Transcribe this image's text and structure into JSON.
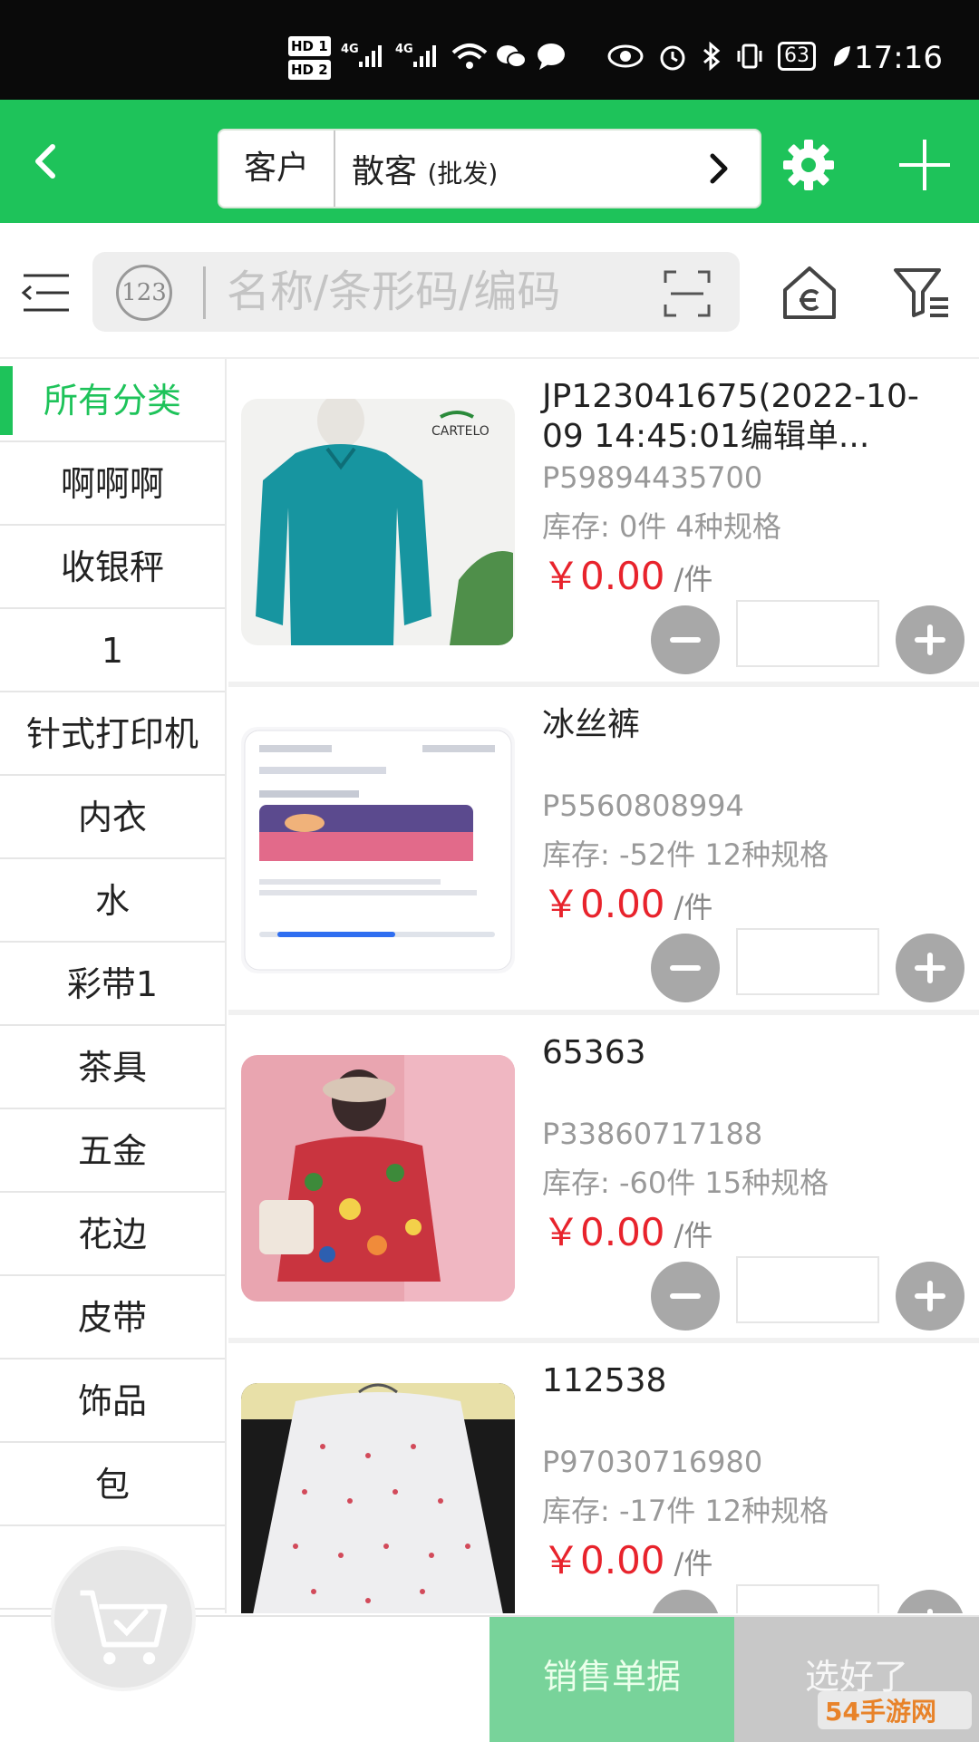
{
  "status_bar": {
    "hd1": "HD 1",
    "hd2": "HD 2",
    "net1": "4G",
    "net2": "4G",
    "battery": "63",
    "time": "17:16"
  },
  "header": {
    "customer_label": "客户",
    "customer_value": "散客",
    "customer_sub": "(批发)",
    "accent_color": "#1ec35a"
  },
  "search": {
    "numeric_badge": "123",
    "placeholder": "名称/条形码/编码"
  },
  "categories": [
    {
      "label": "所有分类",
      "active": true
    },
    {
      "label": "啊啊啊"
    },
    {
      "label": "收银秤"
    },
    {
      "label": "1"
    },
    {
      "label": "针式打印机"
    },
    {
      "label": "内衣"
    },
    {
      "label": "水"
    },
    {
      "label": "彩带1"
    },
    {
      "label": "茶具"
    },
    {
      "label": "五金"
    },
    {
      "label": "花边"
    },
    {
      "label": "皮带"
    },
    {
      "label": "饰品"
    },
    {
      "label": "包"
    },
    {
      "label": "..."
    }
  ],
  "products": [
    {
      "name": "JP123041675(2022-10-09 14:45:01编辑单...",
      "code": "P59894435700",
      "stock": "库存: 0件 4种规格",
      "price": "￥0.00",
      "unit": "/件",
      "image_brand": "CARTELO"
    },
    {
      "name": "冰丝裤",
      "code": "P5560808994",
      "stock": "库存: -52件 12种规格",
      "price": "￥0.00",
      "unit": "/件"
    },
    {
      "name": "65363",
      "code": "P33860717188",
      "stock": "库存: -60件 15种规格",
      "price": "￥0.00",
      "unit": "/件"
    },
    {
      "name": "112538",
      "code": "P97030716980",
      "stock": "库存: -17件 12种规格",
      "price": "￥0.00",
      "unit": "/件"
    }
  ],
  "bottom": {
    "sales_doc": "销售单据",
    "done": "选好了"
  },
  "watermark": "54手游网"
}
